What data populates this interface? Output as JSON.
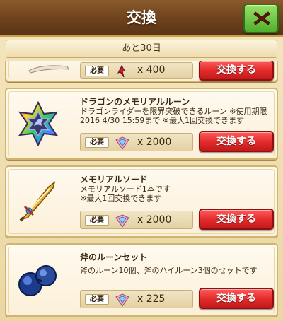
{
  "header": {
    "title": "交換"
  },
  "remaining": {
    "label": "あと30日"
  },
  "items": [
    {
      "name": "",
      "desc": "",
      "cost_label": "必要",
      "cost_value": "x 400",
      "button": "交換する"
    },
    {
      "name": "ドラゴンのメモリアルルーン",
      "desc": "ドラゴンライダーを限界突破できるルーン ※使用期限\n2016 4/30 15:59まで ※最大1回交換できます",
      "cost_label": "必要",
      "cost_value": "x 2000",
      "button": "交換する"
    },
    {
      "name": "メモリアルソード",
      "desc": "メモリアルソード1本です\n※最大1回交換できます",
      "cost_label": "必要",
      "cost_value": "x 2000",
      "button": "交換する"
    },
    {
      "name": "斧のルーンセット",
      "desc": "斧のルーン10個、斧のハイルーン3個のセットです",
      "cost_label": "必要",
      "cost_value": "x 225",
      "button": "交換する"
    }
  ],
  "colors": {
    "exchange_button": "#e12a2a",
    "close_button": "#4fae2c",
    "header": "#6e421d"
  }
}
